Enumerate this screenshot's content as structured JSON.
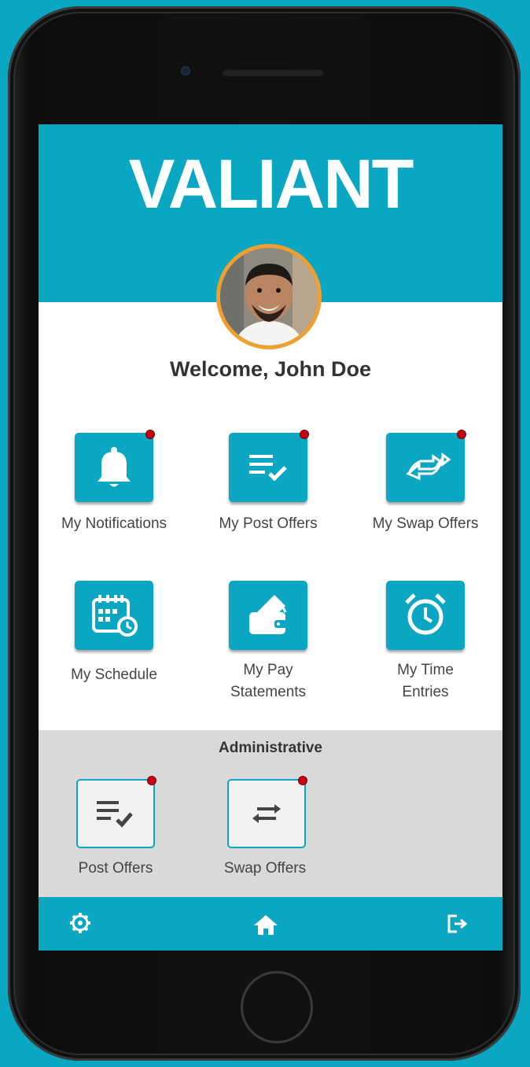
{
  "app": {
    "logo_text": "VALIANT",
    "brand_color": "#0aa6c2"
  },
  "header": {
    "welcome": "Welcome, John Doe"
  },
  "tiles": [
    {
      "label": "My Notifications",
      "icon": "bell-icon",
      "has_badge": true
    },
    {
      "label": "My Post Offers",
      "icon": "list-check-icon",
      "has_badge": true
    },
    {
      "label": "My Swap Offers",
      "icon": "swap-arrows-icon",
      "has_badge": true
    },
    {
      "label": "My Schedule",
      "icon": "calendar-clock-icon",
      "has_badge": false
    },
    {
      "label_line1": "My Pay",
      "label_line2": "Statements",
      "icon": "wallet-icon",
      "has_badge": false
    },
    {
      "label_line1": "My Time",
      "label_line2": "Entries",
      "icon": "alarm-clock-icon",
      "has_badge": false
    }
  ],
  "admin": {
    "title": "Administrative",
    "tiles": [
      {
        "label": "Post Offers",
        "icon": "list-check-icon",
        "has_badge": true
      },
      {
        "label": "Swap Offers",
        "icon": "swap-arrows-icon",
        "has_badge": true
      }
    ]
  },
  "footer": {
    "icons": [
      "gear-icon",
      "home-icon",
      "logout-icon"
    ]
  },
  "badge_color": "#c40010"
}
